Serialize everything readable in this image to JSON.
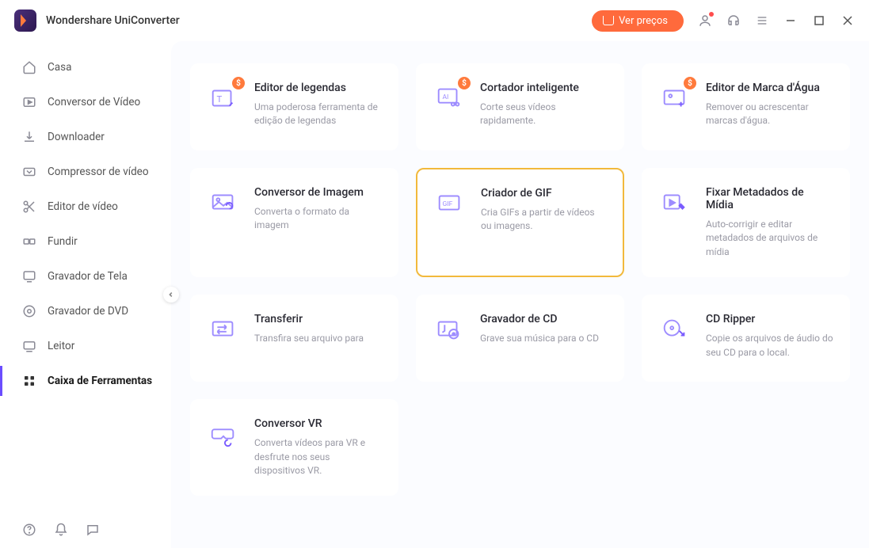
{
  "app": {
    "title": "Wondershare UniConverter"
  },
  "titlebar": {
    "price_label": "Ver preços"
  },
  "sidebar": {
    "items": [
      {
        "label": "Casa"
      },
      {
        "label": "Conversor de Vídeo"
      },
      {
        "label": "Downloader"
      },
      {
        "label": "Compressor de vídeo"
      },
      {
        "label": "Editor de vídeo"
      },
      {
        "label": "Fundir"
      },
      {
        "label": "Gravador de Tela"
      },
      {
        "label": "Gravador de DVD"
      },
      {
        "label": "Leitor"
      },
      {
        "label": "Caixa de Ferramentas"
      }
    ]
  },
  "tools": [
    {
      "title": "Editor de legendas",
      "desc": "Uma poderosa ferramenta de edição de legendas",
      "paid": true
    },
    {
      "title": "Cortador inteligente",
      "desc": "Corte seus vídeos rapidamente.",
      "paid": true
    },
    {
      "title": "Editor de Marca d'Água",
      "desc": "Remover ou acrescentar marcas d'água.",
      "paid": true
    },
    {
      "title": "Conversor de Imagem",
      "desc": "Converta o formato da imagem",
      "paid": false
    },
    {
      "title": "Criador de GIF",
      "desc": "Cria GIFs a partir de vídeos ou imagens.",
      "paid": false,
      "highlighted": true
    },
    {
      "title": "Fixar Metadados de Mídia",
      "desc": "Auto-corrigir e editar metadados de arquivos de mídia",
      "paid": false
    },
    {
      "title": "Transferir",
      "desc": "Transfira seu arquivo para",
      "paid": false
    },
    {
      "title": "Gravador de CD",
      "desc": "Grave sua música para o CD",
      "paid": false
    },
    {
      "title": "CD Ripper",
      "desc": "Copie os arquivos de áudio do seu CD para o local.",
      "paid": false
    },
    {
      "title": "Conversor VR",
      "desc": "Converta vídeos para VR e desfrute nos seus dispositivos VR.",
      "paid": false
    }
  ],
  "badge": {
    "dollar": "$"
  }
}
